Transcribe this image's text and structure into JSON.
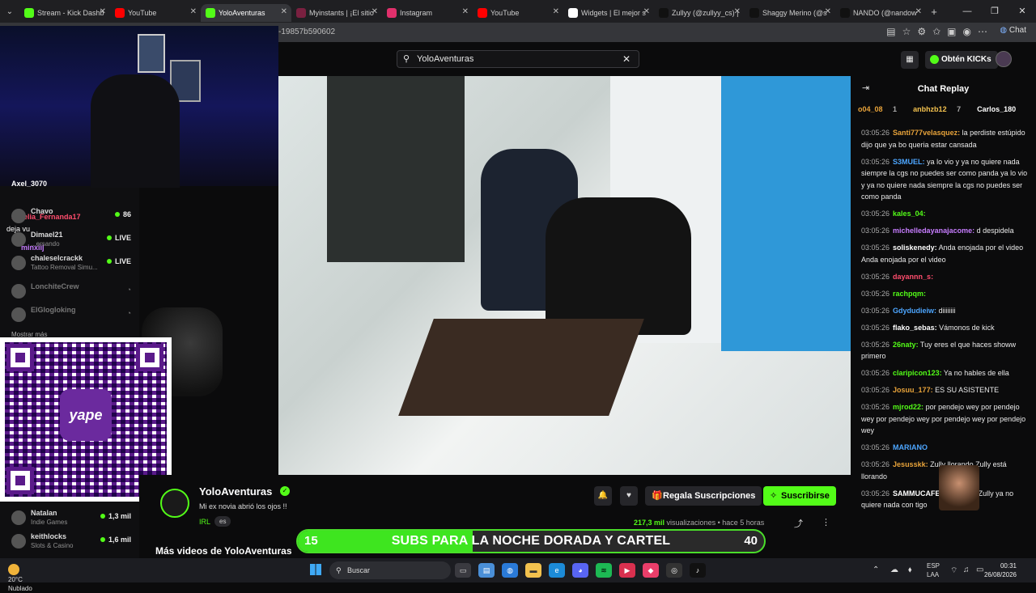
{
  "tabs": [
    {
      "label": "Stream - Kick Dashb",
      "color": "#53fc18"
    },
    {
      "label": "YouTube",
      "color": "#ff0000"
    },
    {
      "label": "YoloAventuras",
      "color": "#53fc18"
    },
    {
      "label": "Myinstants | ¡El sitio",
      "color": "#7a2040"
    },
    {
      "label": "Instagram",
      "color": "#e1306c"
    },
    {
      "label": "YouTube",
      "color": "#ff0000"
    },
    {
      "label": "Widgets | El mejor s",
      "color": "#ffffff"
    },
    {
      "label": "Zullyy (@zullyy_cs) |",
      "color": "#111111"
    },
    {
      "label": "Shaggy Merino (@s",
      "color": "#111111"
    },
    {
      "label": "NANDO (@nandow",
      "color": "#111111"
    }
  ],
  "new_tab": "+",
  "address": {
    "url": "-19857b590602"
  },
  "toolbar": {
    "chat_label": "Chat"
  },
  "header": {
    "search_value": "YoloAventuras",
    "get_kicks": "Obtén KICKs"
  },
  "sidebar": {
    "overlay_user": "Axel_3070",
    "overlay_user2": "Karelia_Fernanda17",
    "overlay_user3": "minxiij",
    "overlay_msg": "deja vu",
    "items": [
      {
        "name": "Chavo",
        "category": "",
        "viewers": "86"
      },
      {
        "name": "Dimael21",
        "category": "...ersando",
        "status": "LIVE"
      },
      {
        "name": "chaleselcrackk",
        "category": "Tattoo Removal Simu...",
        "status": "LIVE"
      },
      {
        "name": "LonchiteCrew",
        "category": ""
      },
      {
        "name": "ElGlogloking",
        "category": ""
      }
    ],
    "show_more": "Mostrar más",
    "bottom_items": [
      {
        "name": "Natalan",
        "category": "Indie Games",
        "viewers": "1,3 mil"
      },
      {
        "name": "keithlocks",
        "category": "Slots & Casino",
        "viewers": "1,6 mil"
      }
    ]
  },
  "qr": {
    "brand": "yape"
  },
  "channel": {
    "name": "YoloAventuras",
    "stream_title": "Mi ex novia abrió los ojos !!",
    "category": "IRL",
    "language": "es",
    "gift_button": "Regala Suscripciones",
    "subscribe_button": "Suscribirse",
    "views_count": "217,3 mil",
    "views_label": "visualizaciones",
    "time_ago": "hace 5 horas",
    "more_videos": "Más videos de YoloAventuras"
  },
  "subs_goal": {
    "current": "15",
    "text": "SUBS PARA LA NOCHE DORADA Y CARTEL",
    "target": "40",
    "progress": 0.375
  },
  "chat": {
    "title": "Chat Replay",
    "gifters": [
      {
        "name": "o04_08",
        "count": "1",
        "color": "#e8a33a"
      },
      {
        "name": "anbhzb12",
        "count": "7",
        "color": "#f2c14e"
      },
      {
        "name": "Carlos_180",
        "count": "",
        "color": "#ffffff"
      }
    ],
    "messages": [
      {
        "time": "03:05:26",
        "user": "Santi777velasquez:",
        "color": "#e8a33a",
        "text": "la perdiste estúpido dijo que ya bo queria estar cansada"
      },
      {
        "time": "03:05:26",
        "user": "S3MUEL:",
        "color": "#4da6ff",
        "text": "ya lo vio y ya no quiere nada siempre la cgs no puedes ser como panda ya lo vio y ya no quiere nada siempre la cgs no puedes ser como panda"
      },
      {
        "time": "03:05:26",
        "user": "kales_04:",
        "color": "#53fc18",
        "text": ""
      },
      {
        "time": "03:05:26",
        "user": "michelledayanajacome:",
        "color": "#c77dff",
        "text": "d despidela"
      },
      {
        "time": "03:05:26",
        "user": "soliskenedy:",
        "color": "#ffffff",
        "text": "Anda enojada por el video Anda enojada por el video"
      },
      {
        "time": "03:05:26",
        "user": "dayannn_s:",
        "color": "#ff4d6d",
        "text": ""
      },
      {
        "time": "03:05:26",
        "user": "rachpqm:",
        "color": "#53fc18",
        "text": ""
      },
      {
        "time": "03:05:26",
        "user": "Gdydudieiw:",
        "color": "#4da6ff",
        "text": "diiiiiiii"
      },
      {
        "time": "03:05:26",
        "user": "flako_sebas:",
        "color": "#ffffff",
        "text": "Vámonos de kick"
      },
      {
        "time": "03:05:26",
        "user": "26naty:",
        "color": "#53fc18",
        "text": "Tuy eres el que haces showw primero"
      },
      {
        "time": "03:05:26",
        "user": "claripicon123:",
        "color": "#53fc18",
        "text": "Ya no hables de ella"
      },
      {
        "time": "03:05:26",
        "user": "Josuu_177:",
        "color": "#e8a33a",
        "text": "ES SU ASISTENTE"
      },
      {
        "time": "03:05:26",
        "user": "mjrod22:",
        "color": "#53fc18",
        "text": "por pendejo wey por pendejo wey por pendejo wey por pendejo wey por pendejo wey"
      },
      {
        "time": "03:05:26",
        "user": "MARIANO",
        "color": "#4da6ff",
        "text": ""
      },
      {
        "time": "03:05:26",
        "user": "Jesusskk:",
        "color": "#e8a33a",
        "text": "Zully llorando Zully está llorando"
      },
      {
        "time": "03:05:26",
        "user": "SAMMUCAFE:",
        "color": "#ffffff",
        "text": "dicen que Zully ya no quiere nada con tigo"
      }
    ]
  },
  "taskbar": {
    "temp": "20°C",
    "weather": "Nublado",
    "search": "Buscar",
    "lang1": "ESP",
    "lang2": "LAA",
    "time": "00:31",
    "date": "26/08/2026"
  }
}
